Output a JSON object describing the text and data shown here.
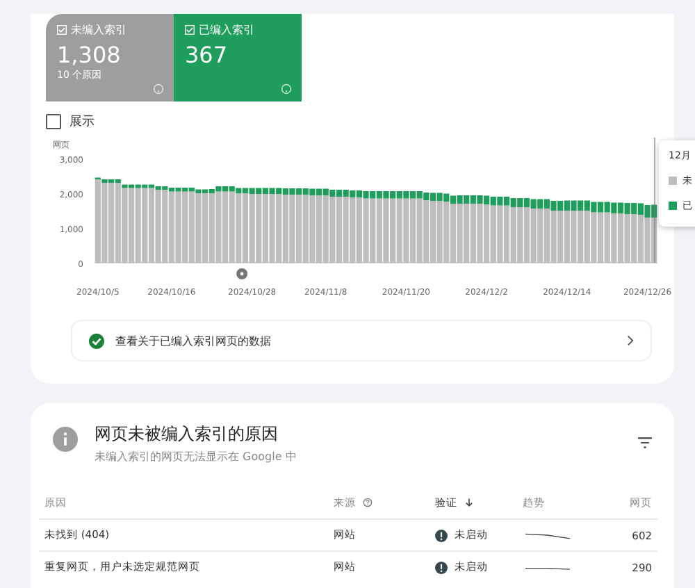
{
  "summary_tiles": [
    {
      "label": "未编入索引",
      "value": "1,308",
      "caption": "10 个原因",
      "selected": true,
      "color": "#9e9e9e"
    },
    {
      "label": "已编入索引",
      "value": "367",
      "selected": true,
      "color": "#1e9d5c"
    }
  ],
  "impressions_toggle": {
    "label": "展示",
    "checked": false
  },
  "chart": {
    "chart_data": {
      "type": "bar",
      "stacked": true,
      "ylabel": "网页",
      "categories": [
        "2024/10/5",
        null,
        null,
        null,
        null,
        null,
        null,
        null,
        null,
        null,
        null,
        "2024/10/16",
        null,
        null,
        null,
        null,
        null,
        null,
        null,
        null,
        null,
        null,
        null,
        "2024/10/28",
        null,
        null,
        null,
        null,
        null,
        null,
        null,
        null,
        null,
        null,
        "2024/11/8",
        null,
        null,
        null,
        null,
        null,
        null,
        null,
        null,
        null,
        null,
        null,
        "2024/11/20",
        null,
        null,
        null,
        null,
        null,
        null,
        null,
        null,
        null,
        null,
        null,
        "2024/12/2",
        null,
        null,
        null,
        null,
        null,
        null,
        null,
        null,
        null,
        null,
        null,
        "2024/12/14",
        null,
        null,
        null,
        null,
        null,
        null,
        null,
        null,
        null,
        null,
        null,
        "2024/12/26",
        null
      ],
      "series": [
        {
          "name": "未",
          "color": "#bdbdbd",
          "values": [
            2400,
            2300,
            2300,
            2300,
            2150,
            2150,
            2150,
            2150,
            2150,
            2100,
            2100,
            2050,
            2050,
            2050,
            2050,
            2000,
            2000,
            2000,
            2050,
            2050,
            2050,
            2000,
            2000,
            1980,
            1980,
            1980,
            1980,
            1980,
            1960,
            1960,
            1960,
            1960,
            1940,
            1940,
            1940,
            1900,
            1900,
            1900,
            1880,
            1880,
            1850,
            1850,
            1850,
            1850,
            1850,
            1850,
            1850,
            1850,
            1850,
            1800,
            1780,
            1780,
            1760,
            1700,
            1700,
            1700,
            1700,
            1700,
            1680,
            1650,
            1650,
            1650,
            1600,
            1600,
            1600,
            1560,
            1560,
            1560,
            1500,
            1500,
            1500,
            1500,
            1500,
            1500,
            1450,
            1450,
            1450,
            1420,
            1420,
            1400,
            1400,
            1380,
            1300,
            1300
          ]
        },
        {
          "name": "已",
          "color": "#1e9d5c",
          "values": [
            50,
            100,
            100,
            100,
            100,
            100,
            100,
            100,
            100,
            100,
            100,
            110,
            110,
            110,
            110,
            110,
            110,
            120,
            150,
            150,
            150,
            150,
            150,
            170,
            170,
            170,
            170,
            170,
            180,
            180,
            180,
            180,
            190,
            190,
            190,
            200,
            200,
            200,
            200,
            200,
            210,
            210,
            210,
            210,
            210,
            210,
            210,
            210,
            210,
            220,
            230,
            230,
            230,
            230,
            240,
            240,
            240,
            240,
            250,
            250,
            250,
            250,
            260,
            260,
            260,
            270,
            270,
            270,
            280,
            280,
            290,
            290,
            290,
            290,
            300,
            300,
            300,
            310,
            310,
            320,
            320,
            330,
            360,
            370
          ]
        }
      ],
      "ylim": [
        0,
        3000
      ],
      "yticks": [
        0,
        {
          "value": 1000,
          "label": "1,000"
        },
        {
          "value": 2000,
          "label": "2,000"
        },
        {
          "value": 3000,
          "label": "3,000"
        }
      ]
    },
    "tooltip": {
      "title": "12月"
    }
  },
  "indexed_link": {
    "label": "查看关于已编入索引网页的数据"
  },
  "reasons": {
    "title": "网页未被编入索引的原因",
    "subtitle": "未编入索引的网页无法显示在 Google 中",
    "columns": [
      "原因",
      "来源",
      "验证",
      "趋势",
      "网页"
    ],
    "rows": [
      {
        "reason": "未找到 (404)",
        "source": "网站",
        "validation": "未启动",
        "pages": "602"
      },
      {
        "reason": "重复网页，用户未选定规范网页",
        "source": "网站",
        "validation": "未启动",
        "pages": "290"
      }
    ]
  }
}
